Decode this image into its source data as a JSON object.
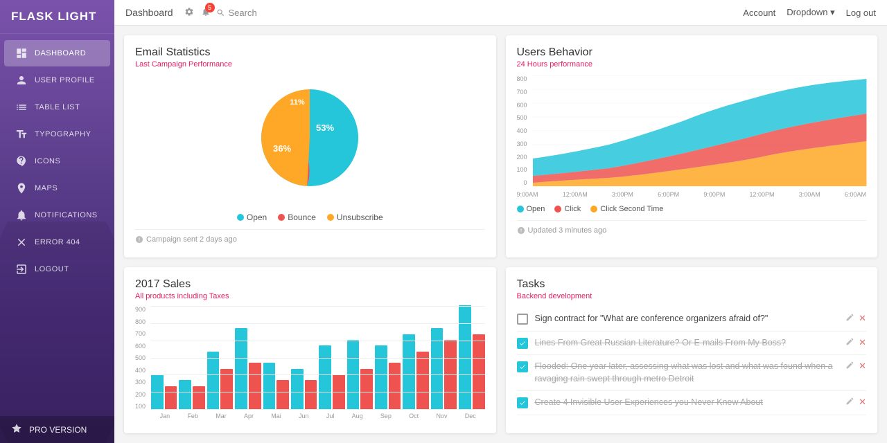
{
  "app": {
    "name": "FLASK LIGHT"
  },
  "topbar": {
    "breadcrumb": "Dashboard",
    "search_placeholder": "Search",
    "notification_count": "5",
    "account_label": "Account",
    "dropdown_label": "Dropdown",
    "logout_label": "Log out"
  },
  "sidebar": {
    "items": [
      {
        "id": "dashboard",
        "label": "DASHBOARD",
        "active": true
      },
      {
        "id": "user-profile",
        "label": "USER PROFILE",
        "active": false
      },
      {
        "id": "table-list",
        "label": "TABLE LIST",
        "active": false
      },
      {
        "id": "typography",
        "label": "TYPOGRAPHY",
        "active": false
      },
      {
        "id": "icons",
        "label": "ICONS",
        "active": false
      },
      {
        "id": "maps",
        "label": "MAPS",
        "active": false
      },
      {
        "id": "notifications",
        "label": "NOTIFICATIONS",
        "active": false
      },
      {
        "id": "error404",
        "label": "ERROR 404",
        "active": false
      },
      {
        "id": "logout",
        "label": "LOGOUT",
        "active": false
      }
    ],
    "pro_label": "PRO VERSION"
  },
  "email_stats": {
    "title": "Email Statistics",
    "subtitle": "Last Campaign Performance",
    "segments": [
      {
        "label": "Open",
        "value": 53,
        "color": "#26c6da"
      },
      {
        "label": "Bounce",
        "value": 36,
        "color": "#ef5350"
      },
      {
        "label": "Unsubscribe",
        "value": 11,
        "color": "#ffa726"
      }
    ],
    "footer": "Campaign sent 2 days ago"
  },
  "users_behavior": {
    "title": "Users Behavior",
    "subtitle": "24 Hours performance",
    "legend": [
      {
        "label": "Open",
        "color": "#26c6da"
      },
      {
        "label": "Click",
        "color": "#ef5350"
      },
      {
        "label": "Click Second Time",
        "color": "#ffa726"
      }
    ],
    "x_labels": [
      "9:00AM",
      "12:00AM",
      "3:00PM",
      "6:00PM",
      "9:00PM",
      "12:00PM",
      "3:00AM",
      "6:00AM"
    ],
    "footer": "Updated 3 minutes ago",
    "y_labels": [
      "0",
      "100",
      "200",
      "300",
      "400",
      "500",
      "600",
      "700",
      "800"
    ]
  },
  "sales_2017": {
    "title": "2017 Sales",
    "subtitle": "All products including Taxes",
    "y_labels": [
      "900",
      "800",
      "700",
      "600",
      "500",
      "400",
      "300",
      "200",
      "100"
    ],
    "months": [
      "Jan",
      "Feb",
      "Mar",
      "Apr",
      "Mai",
      "Jun",
      "Jul",
      "Aug",
      "Sep",
      "Oct",
      "Nov",
      "Dec"
    ],
    "series": [
      {
        "color": "#26c6da",
        "values": [
          3,
          2.5,
          5,
          7,
          4,
          3.5,
          5.5,
          6,
          5.5,
          6.5,
          7,
          9
        ]
      },
      {
        "color": "#ef5350",
        "values": [
          2,
          2,
          3.5,
          4,
          2.5,
          2.5,
          3,
          3.5,
          4,
          5,
          6,
          6.5
        ]
      }
    ]
  },
  "tasks": {
    "title": "Tasks",
    "subtitle": "Backend development",
    "items": [
      {
        "text": "Sign contract for \"What are conference organizers afraid of?\"",
        "checked": false
      },
      {
        "text": "Lines From Great Russian Literature? Or E-mails From My Boss?",
        "checked": true
      },
      {
        "text": "Flooded: One year later, assessing what was lost and what was found when a ravaging rain swept through metro Detroit",
        "checked": true
      },
      {
        "text": "Create 4 Invisible User Experiences you Never Knew About",
        "checked": true
      }
    ]
  }
}
